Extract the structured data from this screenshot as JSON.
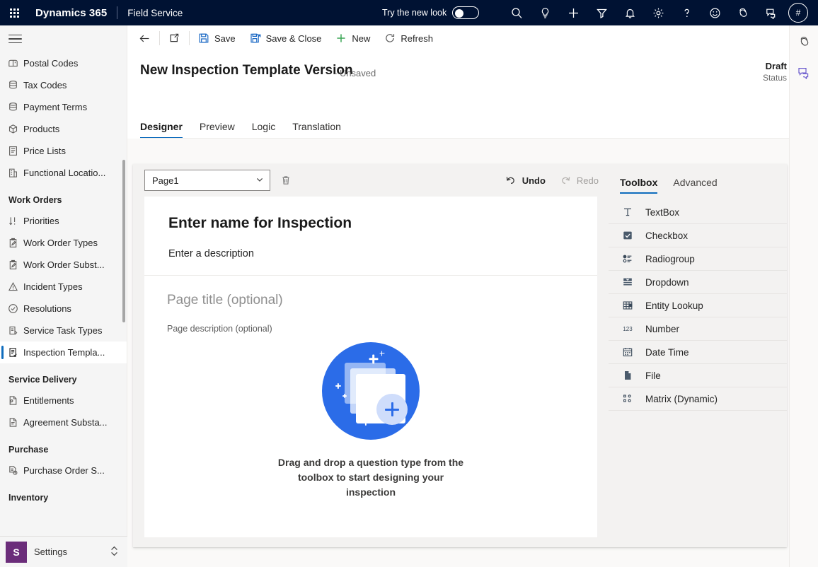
{
  "appbar": {
    "waffle": "app-launcher-icon",
    "brand": "Dynamics 365",
    "app_name": "Field Service",
    "new_look_label": "Try the new look",
    "new_look_state": "off",
    "avatar_initials": "#",
    "icons": [
      "search-icon",
      "lightbulb-icon",
      "plus-icon",
      "filter-icon",
      "bell-icon",
      "gear-icon",
      "help-icon",
      "smiley-icon",
      "copilot-icon",
      "feedback-icon"
    ]
  },
  "sidebar": {
    "items": [
      {
        "label": "Postal Codes",
        "icon": "mailbox-icon",
        "selected": false
      },
      {
        "label": "Tax Codes",
        "icon": "database-icon",
        "selected": false
      },
      {
        "label": "Payment Terms",
        "icon": "database-icon",
        "selected": false
      },
      {
        "label": "Products",
        "icon": "box-icon",
        "selected": false
      },
      {
        "label": "Price Lists",
        "icon": "list-document-icon",
        "selected": false
      },
      {
        "label": "Functional Locatio...",
        "icon": "building-icon",
        "selected": false
      }
    ],
    "groups": [
      {
        "title": "Work Orders",
        "items": [
          {
            "label": "Priorities",
            "icon": "sort-icon",
            "selected": false
          },
          {
            "label": "Work Order Types",
            "icon": "clipboard-pen-icon",
            "selected": false
          },
          {
            "label": "Work Order Subst...",
            "icon": "clipboard-pen-icon",
            "selected": false
          },
          {
            "label": "Incident Types",
            "icon": "warning-triangle-icon",
            "selected": false
          },
          {
            "label": "Resolutions",
            "icon": "check-circle-icon",
            "selected": false
          },
          {
            "label": "Service Task Types",
            "icon": "task-icon",
            "selected": false
          },
          {
            "label": "Inspection Templa...",
            "icon": "inspection-icon",
            "selected": true
          }
        ]
      },
      {
        "title": "Service Delivery",
        "items": [
          {
            "label": "Entitlements",
            "icon": "entitlement-icon",
            "selected": false
          },
          {
            "label": "Agreement Substa...",
            "icon": "agreement-icon",
            "selected": false
          }
        ]
      },
      {
        "title": "Purchase",
        "items": [
          {
            "label": "Purchase Order S...",
            "icon": "purchase-order-icon",
            "selected": false
          }
        ]
      },
      {
        "title": "Inventory",
        "items": []
      }
    ],
    "footer": {
      "badge": "S",
      "label": "Settings",
      "chevron": "updown-chevron-icon"
    }
  },
  "commandbar": {
    "back": "back-arrow-icon",
    "popout": "popout-icon",
    "save": "Save",
    "save_close": "Save & Close",
    "new": "New",
    "refresh": "Refresh"
  },
  "record": {
    "title": "New Inspection Template Version",
    "subtitle": "- Unsaved",
    "status_value": "Draft",
    "status_label": "Status",
    "tabs": [
      {
        "label": "Designer",
        "active": true
      },
      {
        "label": "Preview",
        "active": false
      },
      {
        "label": "Logic",
        "active": false
      },
      {
        "label": "Translation",
        "active": false
      }
    ]
  },
  "designer": {
    "page_select_value": "Page1",
    "delete_icon": "trash-icon",
    "undo_label": "Undo",
    "redo_label": "Redo",
    "undo_enabled": true,
    "redo_enabled": false,
    "inspection_name_placeholder": "Enter name for Inspection",
    "inspection_desc_placeholder": "Enter a description",
    "page_title_placeholder": "Page title (optional)",
    "page_desc_placeholder": "Page description (optional)",
    "empty_state_text": "Drag and drop a question type from the toolbox to start designing your inspection",
    "empty_state_art": "add-pages-illustration"
  },
  "toolbox": {
    "tabs": [
      {
        "label": "Toolbox",
        "active": true
      },
      {
        "label": "Advanced",
        "active": false
      }
    ],
    "items": [
      {
        "label": "TextBox",
        "icon": "textbox-icon"
      },
      {
        "label": "Checkbox",
        "icon": "checkbox-icon"
      },
      {
        "label": "Radiogroup",
        "icon": "radiogroup-icon"
      },
      {
        "label": "Dropdown",
        "icon": "dropdown-icon"
      },
      {
        "label": "Entity Lookup",
        "icon": "entity-lookup-icon"
      },
      {
        "label": "Number",
        "icon": "number-icon"
      },
      {
        "label": "Date Time",
        "icon": "calendar-icon"
      },
      {
        "label": "File",
        "icon": "file-icon"
      },
      {
        "label": "Matrix (Dynamic)",
        "icon": "matrix-icon"
      }
    ]
  },
  "colors": {
    "appbar_bg": "#001233",
    "accent": "#0f6cbd",
    "illustration_blue": "#2b6ce8",
    "settings_purple": "#6b2d7a",
    "new_green": "#3aa655",
    "canvas_gray": "#f3f2f1"
  }
}
